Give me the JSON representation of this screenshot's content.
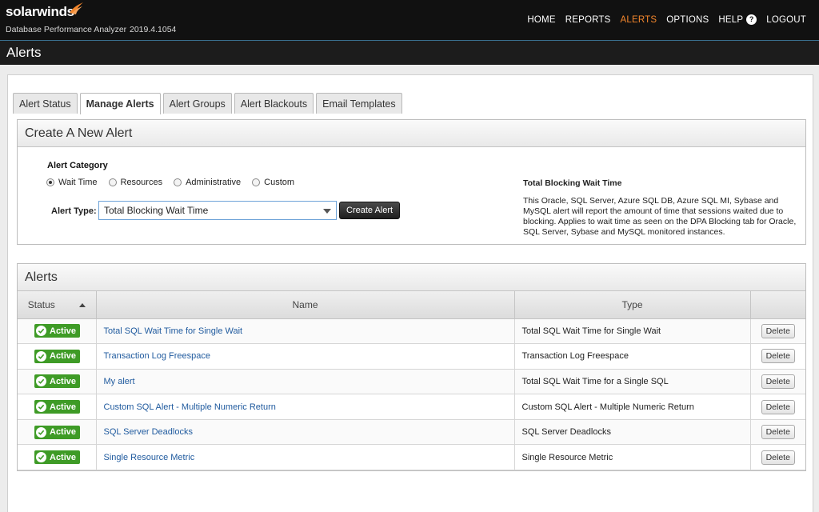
{
  "brand": {
    "logo_text": "solarwinds",
    "product": "Database Performance Analyzer",
    "version": "2019.4.1054"
  },
  "nav": {
    "items": [
      {
        "label": "HOME",
        "active": false
      },
      {
        "label": "REPORTS",
        "active": false
      },
      {
        "label": "ALERTS",
        "active": true
      },
      {
        "label": "OPTIONS",
        "active": false
      },
      {
        "label": "HELP",
        "active": false,
        "icon": "help-icon"
      },
      {
        "label": "LOGOUT",
        "active": false
      }
    ],
    "help_icon_glyph": "?"
  },
  "page_title": "Alerts",
  "tabs": [
    {
      "label": "Alert Status",
      "active": false
    },
    {
      "label": "Manage Alerts",
      "active": true
    },
    {
      "label": "Alert Groups",
      "active": false
    },
    {
      "label": "Alert Blackouts",
      "active": false
    },
    {
      "label": "Email Templates",
      "active": false
    }
  ],
  "create_alert": {
    "header": "Create A New Alert",
    "category_label": "Alert Category",
    "categories": [
      {
        "label": "Wait Time",
        "checked": true
      },
      {
        "label": "Resources",
        "checked": false
      },
      {
        "label": "Administrative",
        "checked": false
      },
      {
        "label": "Custom",
        "checked": false
      }
    ],
    "type_label": "Alert Type:",
    "type_value": "Total Blocking Wait Time",
    "create_button": "Create Alert",
    "description_title": "Total Blocking Wait Time",
    "description_text": "This Oracle, SQL Server, Azure SQL DB, Azure SQL MI, Sybase and MySQL alert will report the amount of time that sessions waited due to blocking. Applies to wait time as seen on the DPA Blocking tab for Oracle, SQL Server, Sybase and MySQL monitored instances."
  },
  "alerts": {
    "header": "Alerts",
    "columns": {
      "status": "Status",
      "name": "Name",
      "type": "Type",
      "action": ""
    },
    "delete_label": "Delete",
    "rows": [
      {
        "status": "Active",
        "name": "Total SQL Wait Time for Single Wait",
        "type": "Total SQL Wait Time for Single Wait"
      },
      {
        "status": "Active",
        "name": "Transaction Log Freespace",
        "type": "Transaction Log Freespace"
      },
      {
        "status": "Active",
        "name": "My alert",
        "type": "Total SQL Wait Time for a Single SQL"
      },
      {
        "status": "Active",
        "name": "Custom SQL Alert - Multiple Numeric Return",
        "type": "Custom SQL Alert - Multiple Numeric Return"
      },
      {
        "status": "Active",
        "name": "SQL Server Deadlocks",
        "type": "SQL Server Deadlocks"
      },
      {
        "status": "Active",
        "name": "Single Resource Metric",
        "type": "Single Resource Metric"
      }
    ]
  },
  "colors": {
    "accent_orange": "#f3862c",
    "active_green": "#3e9b26",
    "link_blue": "#1f5a9e"
  }
}
